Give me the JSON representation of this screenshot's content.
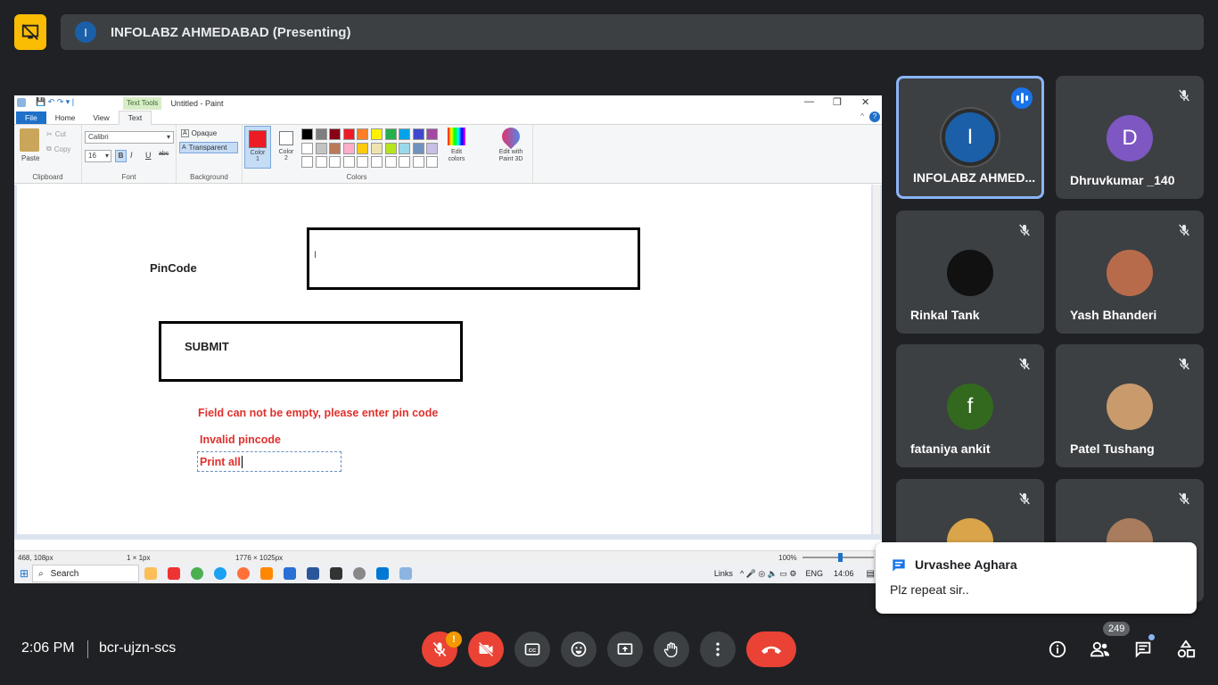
{
  "presenting": {
    "avatar_letter": "I",
    "name": "INFOLABZ AHMEDABAD (Presenting)"
  },
  "paint": {
    "title": "Untitled - Paint",
    "context_tab": "Text Tools",
    "tabs": [
      "File",
      "Home",
      "View",
      "Text"
    ],
    "clipboard": {
      "paste": "Paste",
      "cut": "Cut",
      "copy": "Copy",
      "label": "Clipboard"
    },
    "font": {
      "family": "Calibri",
      "size": "16",
      "label": "Font",
      "bold": "B",
      "italic": "I",
      "underline": "U",
      "strike": "abc"
    },
    "background": {
      "opaque": "Opaque",
      "transparent": "Transparent",
      "label": "Background"
    },
    "color1": {
      "label": "Color",
      "num": "1"
    },
    "color2": {
      "label": "Color",
      "num": "2"
    },
    "colors_label": "Colors",
    "edit_colors": "Edit colors",
    "edit_paint3d": "Edit with Paint 3D",
    "palette_row1": [
      "#000000",
      "#7f7f7f",
      "#880015",
      "#ed1c24",
      "#ff7f27",
      "#fff200",
      "#22b14c",
      "#00a2e8",
      "#3f48cc",
      "#a349a4"
    ],
    "palette_row2": [
      "#ffffff",
      "#c3c3c3",
      "#b97a57",
      "#ffaec9",
      "#ffc90e",
      "#efe4b0",
      "#b5e61d",
      "#99d9ea",
      "#7092be",
      "#c8bfe7"
    ],
    "canvas": {
      "pincode_label": "PinCode",
      "submit_label": "SUBMIT",
      "error1": "Field can not be empty, please enter pin code",
      "error2": "Invalid pincode",
      "editing_text": "Print all"
    },
    "status": {
      "cursor": "468, 108px",
      "selection": "1 × 1px",
      "size": "1776 × 1025px",
      "zoom": "100%"
    },
    "taskbar": {
      "search": "Search",
      "links": "Links",
      "lang": "ENG",
      "time": "14:06"
    }
  },
  "participants": [
    {
      "name": "INFOLABZ AHMED...",
      "avatar": "I",
      "color": "#1a5fa8"
    },
    {
      "name": "Dhruvkumar _140",
      "avatar": "D",
      "color": "#7e57c2"
    },
    {
      "name": "Rinkal Tank",
      "avatar": "",
      "color": "#111111"
    },
    {
      "name": "Yash Bhanderi",
      "avatar": "",
      "color": "#b86b4b"
    },
    {
      "name": "fataniya ankit",
      "avatar": "f",
      "color": "#33691e"
    },
    {
      "name": "Patel Tushang",
      "avatar": "",
      "color": "#c89a6c"
    },
    {
      "name": "",
      "avatar": "",
      "color": "#d9a44a"
    },
    {
      "name": "",
      "avatar": "",
      "color": "#a87c5c"
    }
  ],
  "chat_toast": {
    "sender": "Urvashee Aghara",
    "message": "Plz repeat sir.."
  },
  "footer": {
    "time": "2:06 PM",
    "meeting_code": "bcr-ujzn-scs",
    "mic_badge": "!",
    "participant_count": "249"
  }
}
